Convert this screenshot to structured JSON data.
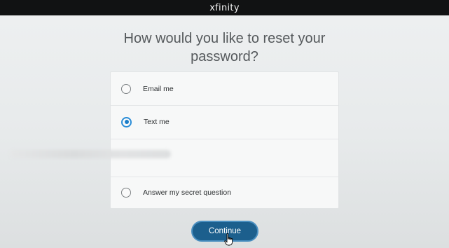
{
  "header": {
    "brand": "xfinity"
  },
  "page": {
    "title": "How would you like to reset your password?"
  },
  "options": [
    {
      "label": "Email me",
      "selected": false
    },
    {
      "label": "Text me",
      "selected": true
    },
    {
      "label": "Answer my secret question",
      "selected": false
    }
  ],
  "actions": {
    "continue_label": "Continue"
  },
  "colors": {
    "accent": "#1c5f8d",
    "radio_selected": "#2b8dd7",
    "topbar": "#111213"
  },
  "icons": {
    "cursor": "hand-pointer-icon"
  }
}
